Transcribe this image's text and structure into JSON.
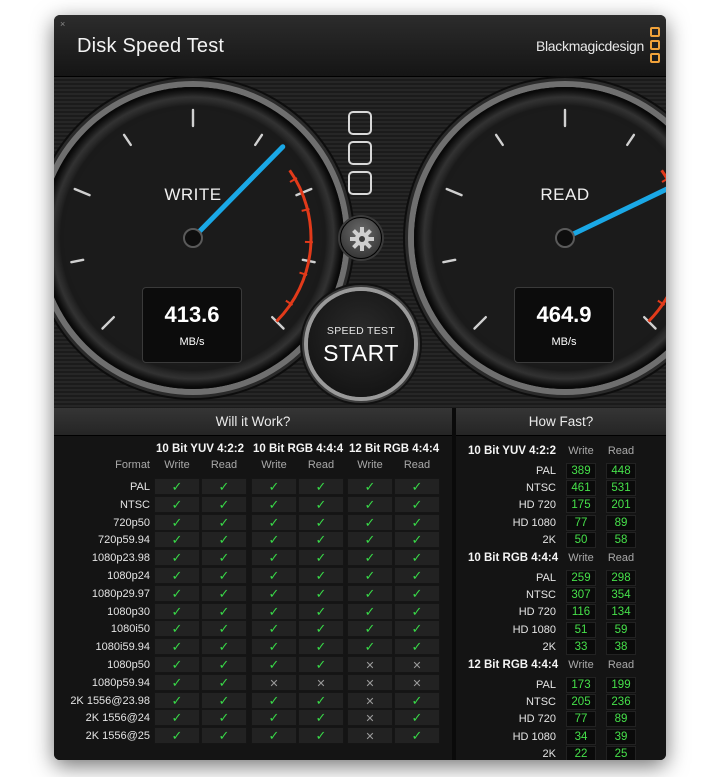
{
  "window": {
    "title": "Disk Speed Test",
    "brand": "Blackmagicdesign",
    "close_glyph": "×"
  },
  "gauges": {
    "write": {
      "label": "WRITE",
      "value": "413.6",
      "unit": "MB/s"
    },
    "read": {
      "label": "READ",
      "value": "464.9",
      "unit": "MB/s"
    }
  },
  "start_button": {
    "top_label": "SPEED TEST",
    "label": "START"
  },
  "colors": {
    "accent": "#f0a23a",
    "needle": "#1aa8e6",
    "redline": "#e23a1a",
    "check": "#38d948",
    "value": "#46e04a"
  },
  "icons": [
    "close-icon",
    "blackmagic-logo-icon",
    "preset-icon",
    "gear-icon",
    "check-icon",
    "cross-icon"
  ],
  "will_it_work": {
    "title": "Will it Work?",
    "format_label": "Format",
    "groups": [
      "10 Bit YUV 4:2:2",
      "10 Bit RGB 4:4:4",
      "12 Bit RGB 4:4:4"
    ],
    "subheaders": [
      "Write",
      "Read"
    ],
    "rows": [
      {
        "format": "PAL",
        "marks": [
          "ok",
          "ok",
          "ok",
          "ok",
          "ok",
          "ok"
        ]
      },
      {
        "format": "NTSC",
        "marks": [
          "ok",
          "ok",
          "ok",
          "ok",
          "ok",
          "ok"
        ]
      },
      {
        "format": "720p50",
        "marks": [
          "ok",
          "ok",
          "ok",
          "ok",
          "ok",
          "ok"
        ]
      },
      {
        "format": "720p59.94",
        "marks": [
          "ok",
          "ok",
          "ok",
          "ok",
          "ok",
          "ok"
        ]
      },
      {
        "format": "1080p23.98",
        "marks": [
          "ok",
          "ok",
          "ok",
          "ok",
          "ok",
          "ok"
        ]
      },
      {
        "format": "1080p24",
        "marks": [
          "ok",
          "ok",
          "ok",
          "ok",
          "ok",
          "ok"
        ]
      },
      {
        "format": "1080p29.97",
        "marks": [
          "ok",
          "ok",
          "ok",
          "ok",
          "ok",
          "ok"
        ]
      },
      {
        "format": "1080p30",
        "marks": [
          "ok",
          "ok",
          "ok",
          "ok",
          "ok",
          "ok"
        ]
      },
      {
        "format": "1080i50",
        "marks": [
          "ok",
          "ok",
          "ok",
          "ok",
          "ok",
          "ok"
        ]
      },
      {
        "format": "1080i59.94",
        "marks": [
          "ok",
          "ok",
          "ok",
          "ok",
          "ok",
          "ok"
        ]
      },
      {
        "format": "1080p50",
        "marks": [
          "ok",
          "ok",
          "ok",
          "ok",
          "no",
          "no"
        ]
      },
      {
        "format": "1080p59.94",
        "marks": [
          "ok",
          "ok",
          "no",
          "no",
          "no",
          "no"
        ]
      },
      {
        "format": "2K 1556@23.98",
        "marks": [
          "ok",
          "ok",
          "ok",
          "ok",
          "no",
          "ok"
        ]
      },
      {
        "format": "2K 1556@24",
        "marks": [
          "ok",
          "ok",
          "ok",
          "ok",
          "no",
          "ok"
        ]
      },
      {
        "format": "2K 1556@25",
        "marks": [
          "ok",
          "ok",
          "ok",
          "ok",
          "no",
          "ok"
        ]
      }
    ]
  },
  "how_fast": {
    "title": "How Fast?",
    "subheaders": [
      "Write",
      "Read"
    ],
    "groups": [
      {
        "name": "10 Bit YUV 4:2:2",
        "rows": [
          {
            "label": "PAL",
            "write": "389",
            "read": "448"
          },
          {
            "label": "NTSC",
            "write": "461",
            "read": "531"
          },
          {
            "label": "HD 720",
            "write": "175",
            "read": "201"
          },
          {
            "label": "HD 1080",
            "write": "77",
            "read": "89"
          },
          {
            "label": "2K",
            "write": "50",
            "read": "58"
          }
        ]
      },
      {
        "name": "10 Bit RGB 4:4:4",
        "rows": [
          {
            "label": "PAL",
            "write": "259",
            "read": "298"
          },
          {
            "label": "NTSC",
            "write": "307",
            "read": "354"
          },
          {
            "label": "HD 720",
            "write": "116",
            "read": "134"
          },
          {
            "label": "HD 1080",
            "write": "51",
            "read": "59"
          },
          {
            "label": "2K",
            "write": "33",
            "read": "38"
          }
        ]
      },
      {
        "name": "12 Bit RGB 4:4:4",
        "rows": [
          {
            "label": "PAL",
            "write": "173",
            "read": "199"
          },
          {
            "label": "NTSC",
            "write": "205",
            "read": "236"
          },
          {
            "label": "HD 720",
            "write": "77",
            "read": "89"
          },
          {
            "label": "HD 1080",
            "write": "34",
            "read": "39"
          },
          {
            "label": "2K",
            "write": "22",
            "read": "25"
          }
        ]
      }
    ]
  }
}
